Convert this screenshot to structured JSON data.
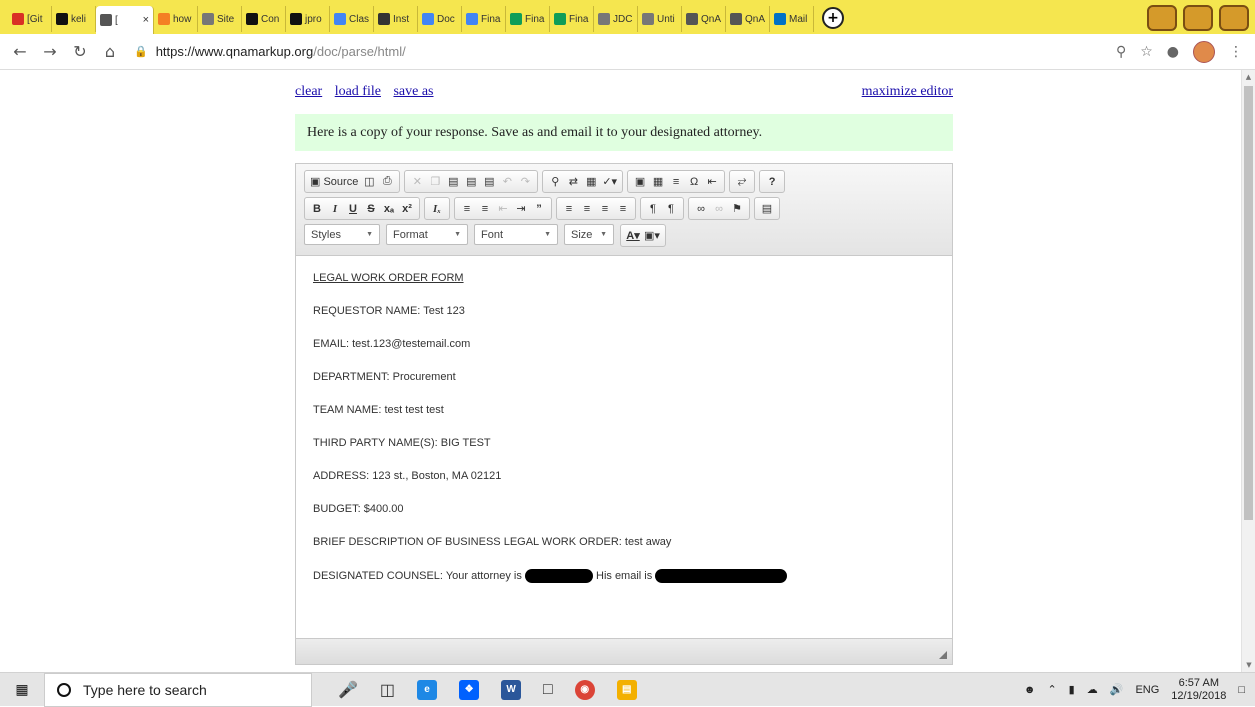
{
  "browser": {
    "tabs": [
      {
        "label": "[Git",
        "icon": "gmail-icon",
        "color": "#d93025"
      },
      {
        "label": "keli",
        "icon": "github-icon",
        "color": "#111111"
      },
      {
        "label": "[",
        "icon": "qna-icon",
        "color": "#555555",
        "active": true
      },
      {
        "label": "how",
        "icon": "stackoverflow-icon",
        "color": "#f48024"
      },
      {
        "label": "Site",
        "icon": "page-icon",
        "color": "#777777"
      },
      {
        "label": "Con",
        "icon": "github-icon",
        "color": "#111111"
      },
      {
        "label": "jpro",
        "icon": "github-icon",
        "color": "#111111"
      },
      {
        "label": "Clas",
        "icon": "docs-icon",
        "color": "#4285f4"
      },
      {
        "label": "Inst",
        "icon": "insta-icon",
        "color": "#333333"
      },
      {
        "label": "Doc",
        "icon": "docs-icon",
        "color": "#4285f4"
      },
      {
        "label": "Fina",
        "icon": "docs-icon",
        "color": "#4285f4"
      },
      {
        "label": "Fina",
        "icon": "sheets-icon",
        "color": "#0f9d58"
      },
      {
        "label": "Fina",
        "icon": "sheets-icon",
        "color": "#0f9d58"
      },
      {
        "label": "JDC",
        "icon": "page-icon",
        "color": "#777777"
      },
      {
        "label": "Unti",
        "icon": "page-icon",
        "color": "#777777"
      },
      {
        "label": "QnA",
        "icon": "qna-icon",
        "color": "#555555"
      },
      {
        "label": "QnA",
        "icon": "qna-icon",
        "color": "#555555"
      },
      {
        "label": "Mail",
        "icon": "outlook-icon",
        "color": "#0072c6"
      }
    ],
    "url_host": "https://www.qnamarkup.org",
    "url_path": "/doc/parse/html/"
  },
  "page": {
    "links": {
      "clear": "clear",
      "load_file": "load file",
      "save_as": "save as",
      "maximize": "maximize editor"
    },
    "notice": "Here is a copy of your response. Save as and email it to your designated attorney."
  },
  "editor": {
    "toolbar": {
      "source": "Source",
      "styles": "Styles",
      "format": "Format",
      "font": "Font",
      "size": "Size"
    },
    "lines": {
      "title": "LEGAL WORK ORDER FORM",
      "requestor": "REQUESTOR NAME: Test 123",
      "email": "EMAIL: test.123@testemail.com",
      "department": "DEPARTMENT: Procurement",
      "team": "TEAM NAME: test test test",
      "third_party": "THIRD PARTY NAME(S): BIG TEST",
      "address": "ADDRESS: 123 st., Boston, MA 02121",
      "budget": "BUDGET: $400.00",
      "description": "BRIEF DESCRIPTION OF BUSINESS LEGAL WORK ORDER: test away",
      "counsel_prefix": "DESIGNATED COUNSEL: Your attorney is",
      "counsel_mid": "His email is"
    }
  },
  "taskbar": {
    "search_placeholder": "Type here to search",
    "language": "ENG",
    "time": "6:57 AM",
    "date": "12/19/2018"
  }
}
